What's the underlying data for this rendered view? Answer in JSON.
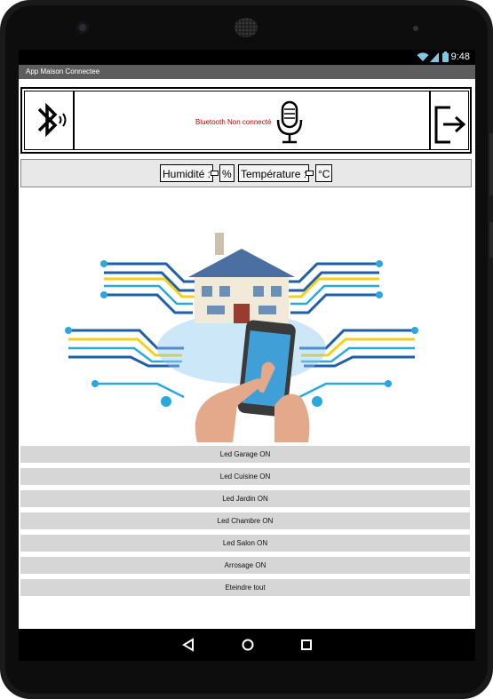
{
  "status_bar": {
    "time": "9:48"
  },
  "app": {
    "title": "App Maison Connectee"
  },
  "header": {
    "bluetooth_status": "Bluetooth Non connecté",
    "bluetooth_status_color": "#cc0000"
  },
  "sensors": {
    "humidity_label": "Humidité :",
    "humidity_unit": "%",
    "temperature_label": "Température :",
    "temperature_unit": "°C"
  },
  "buttons": [
    "Led Garage ON",
    "Led Cuisine ON",
    "Led Jardin ON",
    "Led Chambre ON",
    "Led Salon ON",
    "Arrosage ON",
    "Eteindre tout"
  ],
  "icons": {
    "bluetooth": "bluetooth-icon",
    "microphone": "microphone-icon",
    "exit": "exit-icon",
    "back": "back-triangle-icon",
    "home": "home-circle-icon",
    "recents": "recents-square-icon"
  }
}
